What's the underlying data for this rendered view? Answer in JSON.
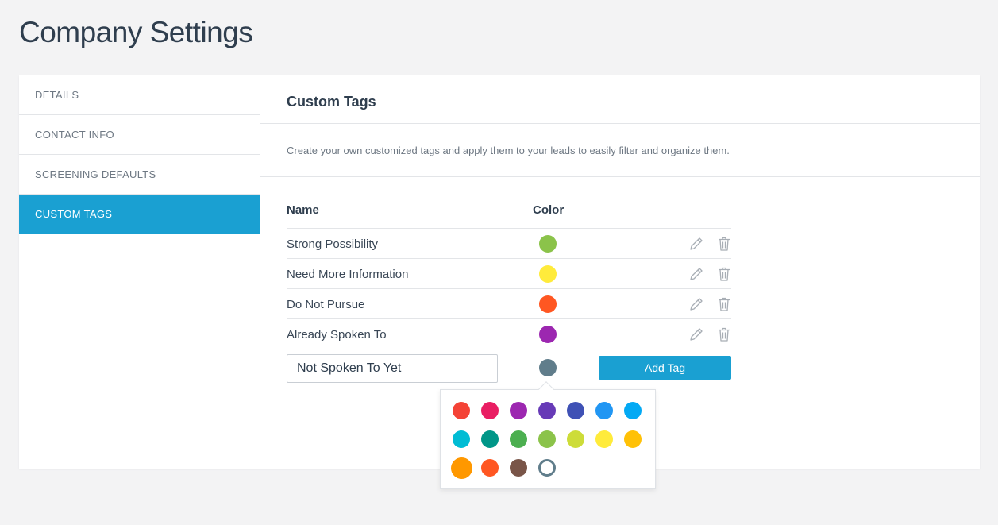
{
  "page": {
    "title": "Company Settings"
  },
  "sidebar": {
    "items": [
      {
        "label": "DETAILS",
        "active": false
      },
      {
        "label": "CONTACT INFO",
        "active": false
      },
      {
        "label": "SCREENING DEFAULTS",
        "active": false
      },
      {
        "label": "CUSTOM TAGS",
        "active": true
      }
    ]
  },
  "section": {
    "title": "Custom Tags",
    "description": "Create your own customized tags and apply them to your leads to easily filter and organize them."
  },
  "table": {
    "headers": {
      "name": "Name",
      "color": "Color"
    },
    "rows": [
      {
        "name": "Strong Possibility",
        "color": "#8bc34a"
      },
      {
        "name": "Need More Information",
        "color": "#ffeb3b"
      },
      {
        "name": "Do Not Pursue",
        "color": "#ff5722"
      },
      {
        "name": "Already Spoken To",
        "color": "#9c27b0"
      }
    ]
  },
  "new_tag": {
    "value": "Not Spoken To Yet",
    "selected_color": "#607d8b",
    "add_label": "Add Tag"
  },
  "color_picker": {
    "swatches": [
      "#f44336",
      "#e91e63",
      "#9c27b0",
      "#673ab7",
      "#3f51b5",
      "#2196f3",
      "#03a9f4",
      "#00bcd4",
      "#009688",
      "#4caf50",
      "#8bc34a",
      "#cddc39",
      "#ffeb3b",
      "#ffc107",
      "#ff9800",
      "#ff5722",
      "#795548",
      "#607d8b"
    ],
    "highlighted": "#ff9800",
    "selected": "#607d8b"
  },
  "icons": {
    "edit": "pencil-icon",
    "delete": "trash-icon"
  }
}
